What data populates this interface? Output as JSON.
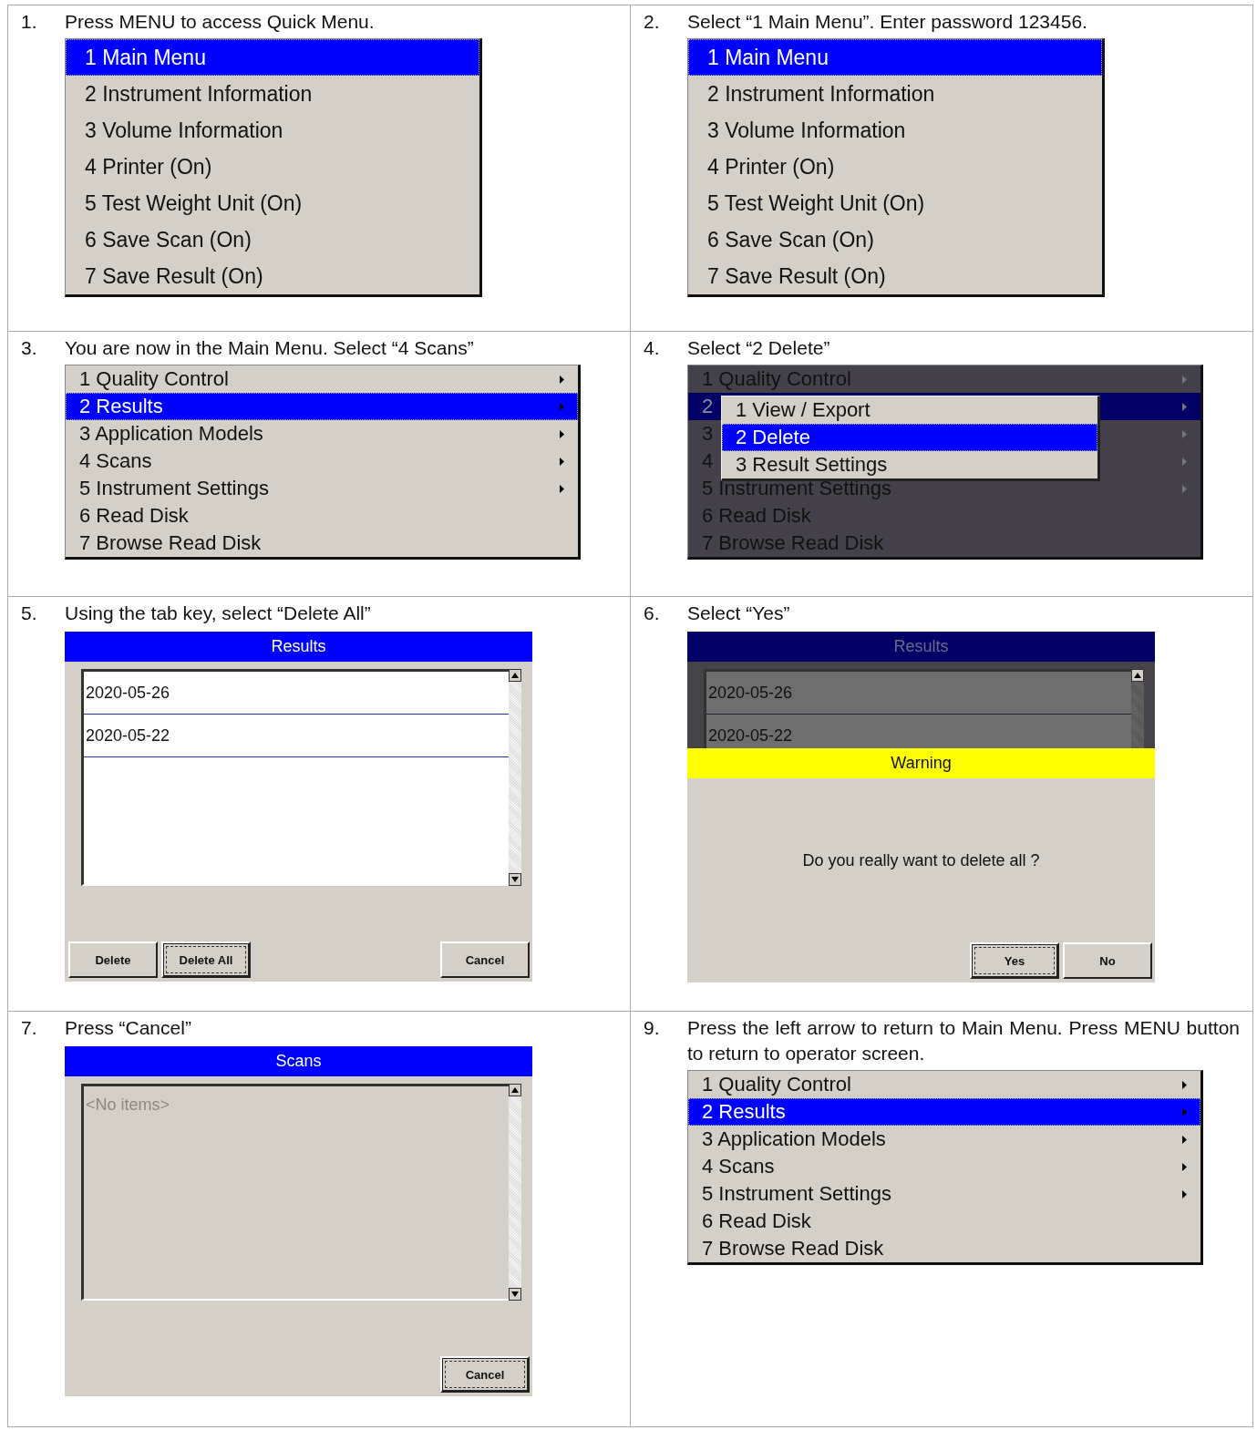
{
  "steps": [
    {
      "number": "1.",
      "instruction": "Press MENU to access Quick Menu.",
      "screen": {
        "kind": "quick_menu",
        "items": [
          {
            "label": "1 Main Menu",
            "selected": true
          },
          {
            "label": "2 Instrument Information",
            "selected": false
          },
          {
            "label": "3 Volume Information",
            "selected": false
          },
          {
            "label": "4 Printer (On)",
            "selected": false
          },
          {
            "label": "5 Test Weight Unit (On)",
            "selected": false
          },
          {
            "label": "6 Save Scan (On)",
            "selected": false
          },
          {
            "label": "7 Save Result (On)",
            "selected": false
          }
        ]
      }
    },
    {
      "number": "2.",
      "instruction": "Select “1 Main Menu”. Enter password 123456.",
      "screen": {
        "kind": "quick_menu",
        "items": [
          {
            "label": "1 Main Menu",
            "selected": true
          },
          {
            "label": "2 Instrument Information",
            "selected": false
          },
          {
            "label": "3 Volume Information",
            "selected": false
          },
          {
            "label": "4 Printer (On)",
            "selected": false
          },
          {
            "label": "5 Test Weight Unit (On)",
            "selected": false
          },
          {
            "label": "6 Save Scan (On)",
            "selected": false
          },
          {
            "label": "7 Save Result (On)",
            "selected": false
          }
        ]
      }
    },
    {
      "number": "3.",
      "instruction": "You are now in the Main Menu. Select “4 Scans”",
      "screen": {
        "kind": "main_menu",
        "dimmed": false,
        "items": [
          {
            "label": "1 Quality Control",
            "selected": false,
            "submenu": true
          },
          {
            "label": "2 Results",
            "selected": true,
            "submenu": true
          },
          {
            "label": "3 Application Models",
            "selected": false,
            "submenu": true
          },
          {
            "label": "4 Scans",
            "selected": false,
            "submenu": true
          },
          {
            "label": "5 Instrument Settings",
            "selected": false,
            "submenu": true
          },
          {
            "label": "6 Read Disk",
            "selected": false,
            "submenu": false
          },
          {
            "label": "7 Browse Read Disk",
            "selected": false,
            "submenu": false
          }
        ]
      }
    },
    {
      "number": "4.",
      "instruction": "Select “2 Delete”",
      "screen": {
        "kind": "main_menu",
        "dimmed": true,
        "items": [
          {
            "label": "1 Quality Control",
            "selected": false,
            "submenu": true
          },
          {
            "label": "2",
            "selected": true,
            "submenu": true
          },
          {
            "label": "3",
            "selected": false,
            "submenu": true
          },
          {
            "label": "4",
            "selected": false,
            "submenu": true
          },
          {
            "label": "5 Instrument Settings",
            "selected": false,
            "submenu": true
          },
          {
            "label": "6 Read Disk",
            "selected": false,
            "submenu": false
          },
          {
            "label": "7 Browse Read Disk",
            "selected": false,
            "submenu": false
          }
        ],
        "popup": [
          {
            "label": "1 View / Export",
            "selected": false
          },
          {
            "label": "2 Delete",
            "selected": true
          },
          {
            "label": "3 Result Settings",
            "selected": false
          }
        ]
      }
    },
    {
      "number": "5.",
      "instruction": "Using the tab key, select “Delete All”",
      "screen": {
        "kind": "list_dialog",
        "title": "Results",
        "items": [
          "2020-05-26",
          "2020-05-22"
        ],
        "buttons_left": [
          {
            "label": "Delete",
            "focused": false
          },
          {
            "label": "Delete All",
            "focused": true
          }
        ],
        "buttons_right": [
          {
            "label": "Cancel",
            "focused": false
          }
        ]
      }
    },
    {
      "number": "6.",
      "instruction": "Select “Yes”",
      "screen": {
        "kind": "warning_dialog",
        "title": "Results",
        "items": [
          "2020-05-26",
          "2020-05-22"
        ],
        "warning_title": "Warning",
        "message": "Do you really want to delete all ?",
        "buttons_right": [
          {
            "label": "Yes",
            "focused": true
          },
          {
            "label": "No",
            "focused": false
          }
        ]
      }
    },
    {
      "number": "7.",
      "instruction": "Press “Cancel”",
      "screen": {
        "kind": "list_dialog",
        "title": "Scans",
        "empty_text": "<No items>",
        "buttons_right": [
          {
            "label": "Cancel",
            "focused": true
          }
        ]
      }
    },
    {
      "number": "9.",
      "instruction": "Press the left arrow to return to Main Menu. Press MENU button to return to operator screen.",
      "screen": {
        "kind": "main_menu",
        "dimmed": false,
        "items": [
          {
            "label": "1 Quality Control",
            "selected": false,
            "submenu": true
          },
          {
            "label": "2 Results",
            "selected": true,
            "submenu": true
          },
          {
            "label": "3 Application Models",
            "selected": false,
            "submenu": true
          },
          {
            "label": "4 Scans",
            "selected": false,
            "submenu": true
          },
          {
            "label": "5 Instrument Settings",
            "selected": false,
            "submenu": true
          },
          {
            "label": "6 Read Disk",
            "selected": false,
            "submenu": false
          },
          {
            "label": "7 Browse Read Disk",
            "selected": false,
            "submenu": false
          }
        ]
      }
    }
  ]
}
